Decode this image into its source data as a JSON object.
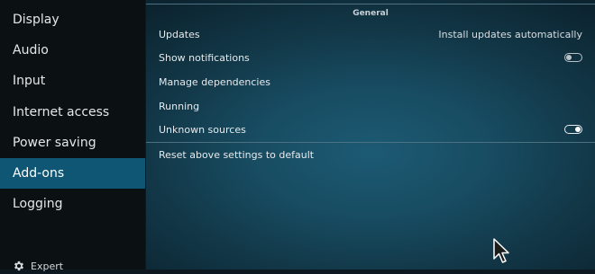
{
  "sidebar": {
    "items": [
      {
        "label": "Display"
      },
      {
        "label": "Audio"
      },
      {
        "label": "Input"
      },
      {
        "label": "Internet access"
      },
      {
        "label": "Power saving"
      },
      {
        "label": "Add-ons"
      },
      {
        "label": "Logging"
      }
    ],
    "active_index": 5,
    "level_label": "Expert",
    "level_icon": "gear-icon"
  },
  "main": {
    "group_title": "General",
    "settings": [
      {
        "label": "Updates",
        "value": "Install updates automatically"
      },
      {
        "label": "Show notifications",
        "toggle": "off"
      },
      {
        "label": "Manage dependencies"
      },
      {
        "label": "Running"
      },
      {
        "label": "Unknown sources",
        "toggle": "on"
      }
    ],
    "reset_label": "Reset above settings to default"
  },
  "colors": {
    "active_item": "#0f5674",
    "sidebar_bg": "#0b1013"
  }
}
